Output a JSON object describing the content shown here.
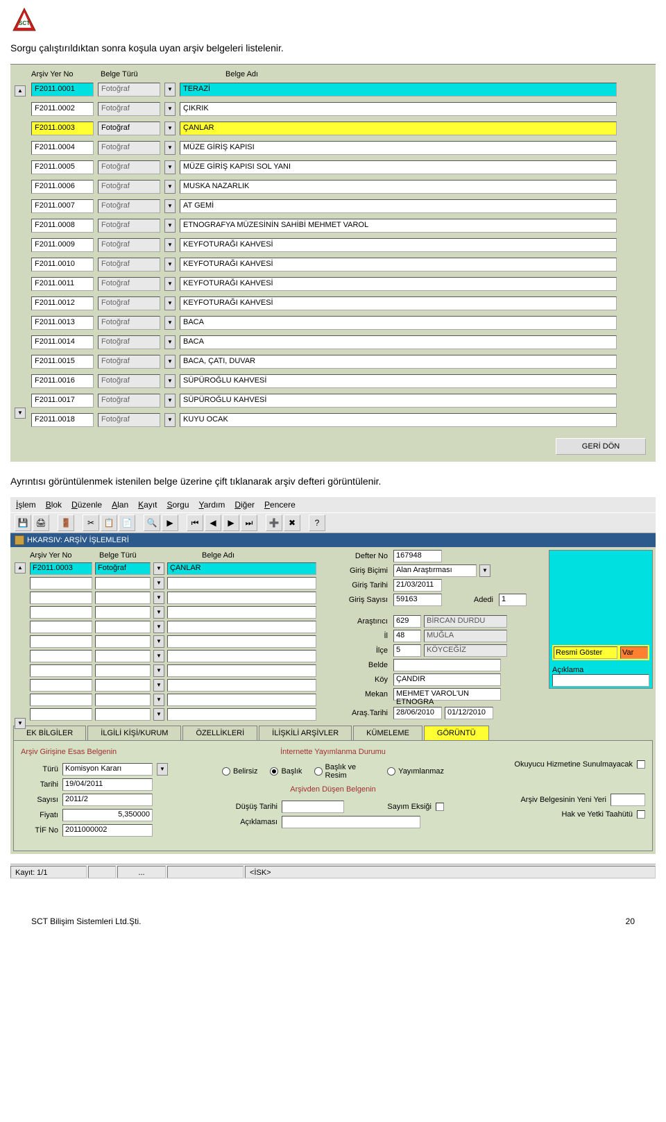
{
  "logo": {
    "top": "SCT"
  },
  "doc": {
    "line1": "Sorgu çalıştırıldıktan sonra koşula uyan arşiv belgeleri listelenir.",
    "line2": "Ayrıntısı görüntülenmek istenilen belge üzerine çift tıklanarak arşiv defteri görüntülenir."
  },
  "list": {
    "headers": {
      "yerno": "Arşiv Yer No",
      "tur": "Belge Türü",
      "adi": "Belge Adı"
    },
    "geri": "GERİ DÖN",
    "rows": [
      {
        "no": "F2011.0001",
        "tur": "Fotoğraf",
        "adi": "TERAZİ",
        "sel": true
      },
      {
        "no": "F2011.0002",
        "tur": "Fotoğraf",
        "adi": "ÇIKRIK"
      },
      {
        "no": "F2011.0003",
        "tur": "Fotoğraf",
        "adi": "ÇANLAR",
        "hl": true
      },
      {
        "no": "F2011.0004",
        "tur": "Fotoğraf",
        "adi": "MÜZE GİRİŞ KAPISI"
      },
      {
        "no": "F2011.0005",
        "tur": "Fotoğraf",
        "adi": "MÜZE GİRİŞ KAPISI SOL YANI"
      },
      {
        "no": "F2011.0006",
        "tur": "Fotoğraf",
        "adi": "MUSKA NAZARLIK"
      },
      {
        "no": "F2011.0007",
        "tur": "Fotoğraf",
        "adi": "AT GEMİ"
      },
      {
        "no": "F2011.0008",
        "tur": "Fotoğraf",
        "adi": "ETNOGRAFYA MÜZESİNİN SAHİBİ MEHMET VAROL"
      },
      {
        "no": "F2011.0009",
        "tur": "Fotoğraf",
        "adi": "KEYFOTURAĞI KAHVESİ"
      },
      {
        "no": "F2011.0010",
        "tur": "Fotoğraf",
        "adi": "KEYFOTURAĞI KAHVESİ"
      },
      {
        "no": "F2011.0011",
        "tur": "Fotoğraf",
        "adi": "KEYFOTURAĞI KAHVESİ"
      },
      {
        "no": "F2011.0012",
        "tur": "Fotoğraf",
        "adi": "KEYFOTURAĞI KAHVESİ"
      },
      {
        "no": "F2011.0013",
        "tur": "Fotoğraf",
        "adi": "BACA"
      },
      {
        "no": "F2011.0014",
        "tur": "Fotoğraf",
        "adi": "BACA"
      },
      {
        "no": "F2011.0015",
        "tur": "Fotoğraf",
        "adi": "BACA, ÇATI, DUVAR"
      },
      {
        "no": "F2011.0016",
        "tur": "Fotoğraf",
        "adi": "SÜPÜROĞLU KAHVESİ"
      },
      {
        "no": "F2011.0017",
        "tur": "Fotoğraf",
        "adi": "SÜPÜROĞLU KAHVESİ"
      },
      {
        "no": "F2011.0018",
        "tur": "Fotoğraf",
        "adi": "KUYU OCAK"
      }
    ]
  },
  "menu": [
    "İşlem",
    "Blok",
    "Düzenle",
    "Alan",
    "Kayıt",
    "Sorgu",
    "Yardım",
    "Diğer",
    "Pencere"
  ],
  "wintitle": "HKARSIV: ARŞİV İŞLEMLERİ",
  "formleft": {
    "headers": {
      "a": "Arşiv Yer No",
      "b": "Belge Türü",
      "c": "Belge Adı"
    },
    "row": {
      "no": "F2011.0003",
      "tur": "Fotoğraf",
      "adi": "ÇANLAR"
    }
  },
  "detail": {
    "defterno_lbl": "Defter No",
    "defterno": "167948",
    "girisbicimi_lbl": "Giriş Biçimi",
    "girisbicimi": "Alan Araştırması",
    "giristarihi_lbl": "Giriş Tarihi",
    "giristarihi": "21/03/2011",
    "girissayisi_lbl": "Giriş Sayısı",
    "girissayisi": "59163",
    "adedi_lbl": "Adedi",
    "adedi": "1",
    "arastirici_lbl": "Araştırıcı",
    "arastirici_no": "629",
    "arastirici": "BİRCAN DURDU",
    "il_lbl": "İl",
    "il_no": "48",
    "il": "MUĞLA",
    "ilce_lbl": "İlçe",
    "ilce_no": "5",
    "ilce": "KÖYCEĞİZ",
    "belde_lbl": "Belde",
    "belde": "",
    "koy_lbl": "Köy",
    "koy": "ÇANDIR",
    "mekan_lbl": "Mekan",
    "mekan": "MEHMET VAROL'UN ETNOGRA",
    "arastarihi_lbl": "Araş.Tarihi",
    "arastarihi1": "28/06/2010",
    "arastarihi2": "01/12/2010",
    "resmi_label": "Resmi Göster",
    "resmi_val": "Var",
    "aciklama": "Açıklama"
  },
  "tabs": [
    "EK BİLGİLER",
    "İLGİLİ KİŞİ/KURUM",
    "ÖZELLİKLERİ",
    "İLİŞKİLİ ARŞİVLER",
    "KÜMELEME",
    "GÖRÜNTÜ"
  ],
  "tabc": {
    "sec1": "Arşiv Girişine Esas Belgenin",
    "turu_lbl": "Türü",
    "turu": "Komisyon Kararı",
    "tarihi_lbl": "Tarihi",
    "tarihi": "19/04/2011",
    "sayisi_lbl": "Sayısı",
    "sayisi": "2011/2",
    "fiyati_lbl": "Fiyatı",
    "fiyati": "5,350000",
    "tifno_lbl": "TİF No",
    "tifno": "2011000002",
    "sec2": "İnternette Yayımlanma Durumu",
    "r1": "Belirsiz",
    "r2": "Başlık",
    "r3": "Başlık ve Resim",
    "r4": "Yayımlanmaz",
    "sec3": "Arşivden Düşen Belgenin",
    "dusus_lbl": "Düşüş Tarihi",
    "acik_lbl": "Açıklaması",
    "sayim_lbl": "Sayım Eksiği",
    "okuyucu_lbl": "Okuyucu Hizmetine Sunulmayacak",
    "yeniyer_lbl": "Arşiv Belgesinin Yeni Yeri",
    "hak_lbl": "Hak ve Yetki Taahütü"
  },
  "status": {
    "kayit": "Kayıt: 1/1",
    "dots": "...",
    "isk": "<İSK>"
  },
  "footer": {
    "company": "SCT Bilişim Sistemleri Ltd.Şti.",
    "page": "20"
  }
}
